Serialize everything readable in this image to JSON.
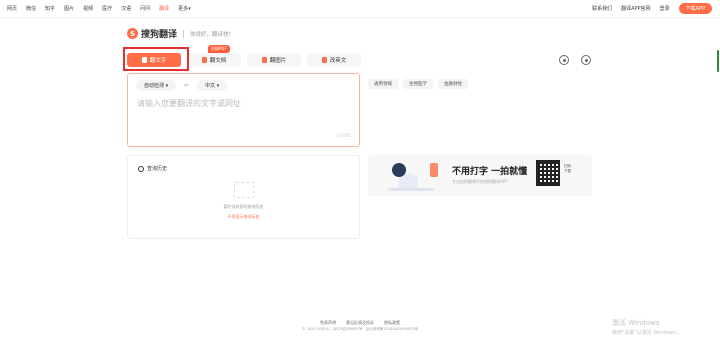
{
  "topnav": {
    "left_items": [
      "网页",
      "微信",
      "知乎",
      "图片",
      "视频",
      "医疗",
      "汉语",
      "问问",
      "翻译",
      "更多▾"
    ],
    "active_index": 8,
    "right_items": [
      "联系我们",
      "翻译APP官网",
      "登录"
    ],
    "download_label": "下载APP"
  },
  "logo": {
    "mark": "S",
    "name": "搜狗翻译",
    "slogan": "你说好，翻译快！"
  },
  "tabs": [
    {
      "label": "翻文字",
      "active": true
    },
    {
      "label": "翻文档",
      "badge": "扫描PDF"
    },
    {
      "label": "翻图片"
    },
    {
      "label": "改英文"
    }
  ],
  "source": {
    "from_lang": "自动检测 ▾",
    "arrow": "⇌",
    "to_lang": "中文 ▾",
    "placeholder": "请输入您要翻译的文字或网址",
    "char_count": "0/5000"
  },
  "domains": [
    "通用领域",
    "生物医学",
    "金融财经"
  ],
  "history": {
    "title": "查询历史",
    "empty_text": "暂时没有您的查询历史",
    "empty_link": "不再显示查询历史"
  },
  "banner": {
    "title": "不用打字  一拍就懂",
    "subtitle": "专业拍照翻译尽在搜狗翻译APP",
    "qr_label": "扫码下载"
  },
  "footer": {
    "links": [
      "免责声明",
      "意见反馈及投诉",
      "隐私政策"
    ],
    "copyright": "© 2022 SOGOU - 京ICP证050897号 - 京公网安备11000002000025号"
  },
  "watermark": {
    "line1": "激活 Windows",
    "line2": "转到\"设置\"以激活 Windows。"
  },
  "colors": {
    "accent": "#ff6e48",
    "highlight": "#e03030"
  }
}
